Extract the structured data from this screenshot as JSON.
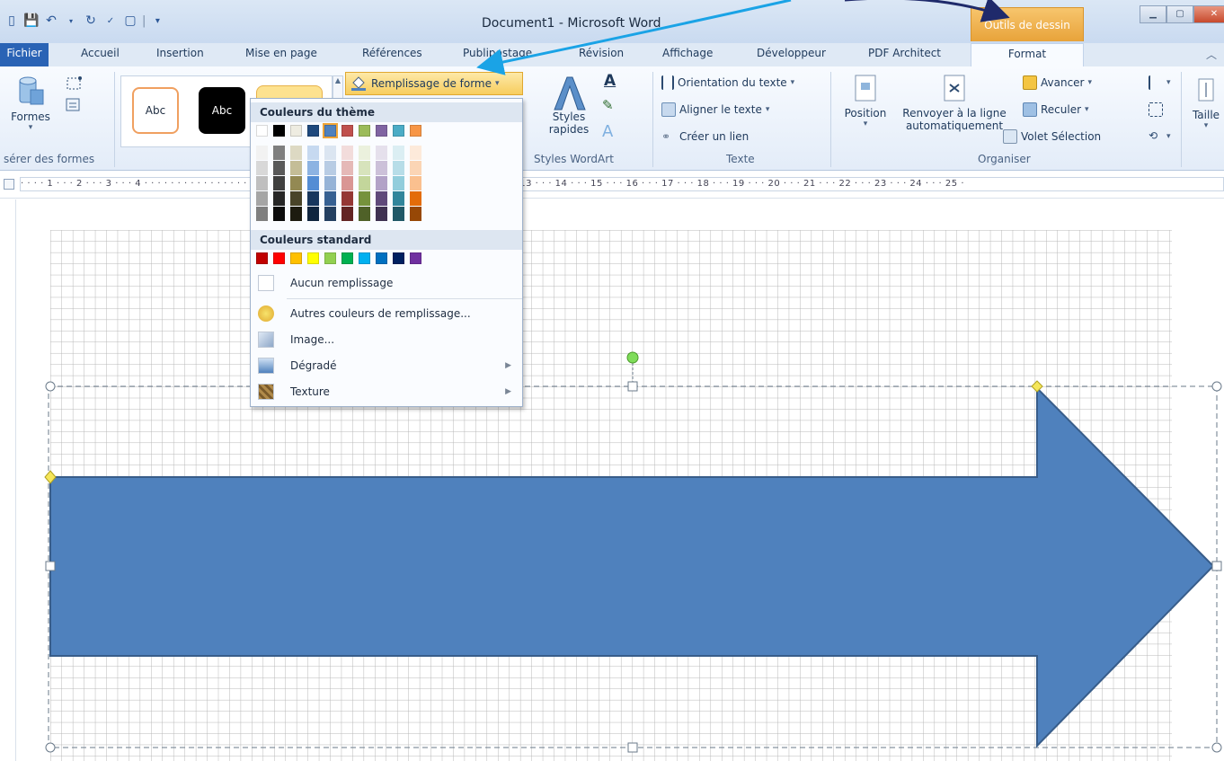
{
  "window": {
    "title": "Document1 - Microsoft Word",
    "context_tab": "Outils de dessin",
    "controls": [
      "minimize",
      "maximize",
      "close"
    ]
  },
  "qat": {
    "icons": [
      "word-icon",
      "save-icon",
      "undo-icon",
      "redo-icon",
      "spellcheck-icon",
      "new-doc-icon",
      "customize-icon"
    ]
  },
  "tabs": [
    "Fichier",
    "Accueil",
    "Insertion",
    "Mise en page",
    "Références",
    "Publipostage",
    "Révision",
    "Affichage",
    "Développeur",
    "PDF Architect",
    "Format"
  ],
  "ribbon": {
    "insert_shapes": {
      "formes_label": "Formes",
      "group_label": "sérer des formes"
    },
    "shape_styles": {
      "sample1": "Abc",
      "sample2": "Abc",
      "fill_button": "Remplissage de forme"
    },
    "wordart": {
      "styles_label_1": "Styles",
      "styles_label_2": "rapides",
      "group_label": "Styles WordArt"
    },
    "text": {
      "orientation": "Orientation du texte",
      "align": "Aligner le texte",
      "link": "Créer un lien",
      "group_label": "Texte"
    },
    "arrange": {
      "position": "Position",
      "wrap_1": "Renvoyer à la ligne",
      "wrap_2": "automatiquement",
      "forward": "Avancer",
      "backward": "Reculer",
      "selection_pane": "Volet Sélection",
      "group_label": "Organiser"
    },
    "size": {
      "label": "Taille"
    }
  },
  "ruler": {
    "text": "· · · · 1 · · · 2 · · · 3 · · · 4 · · · · · · · · · · · · · · · · · · · · · · · · · · · · · · · · · · · · · · · · · · · · · · 11 · · · 12 · · · 13 · · · 14 · · · 15 · · · 16 · · · 17 · · · 18 · · · 19 · · · 20 · · · 21 · · · 22 · · · 23 · · · 24 · · · 25 ·"
  },
  "dropdown": {
    "theme_colors_title": "Couleurs du thème",
    "standard_colors_title": "Couleurs standard",
    "no_fill": "Aucun remplissage",
    "more_colors": "Autres couleurs de remplissage...",
    "image": "Image...",
    "gradient": "Dégradé",
    "texture": "Texture",
    "theme_row": [
      "#ffffff",
      "#000000",
      "#eeece1",
      "#1f497d",
      "#4f81bd",
      "#c0504d",
      "#9bbb59",
      "#8064a2",
      "#4bacc6",
      "#f79646"
    ],
    "theme_shades": [
      [
        "#f2f2f2",
        "#7f7f7f",
        "#ddd9c3",
        "#c6d9f0",
        "#dbe5f1",
        "#f2dcdb",
        "#ebf1dd",
        "#e5e0ec",
        "#dbeef3",
        "#fdeada"
      ],
      [
        "#d8d8d8",
        "#595959",
        "#c4bd97",
        "#8db3e2",
        "#b8cce4",
        "#e5b9b7",
        "#d7e3bc",
        "#ccc1d9",
        "#b7dde8",
        "#fbd5b5"
      ],
      [
        "#bfbfbf",
        "#3f3f3f",
        "#938953",
        "#548dd4",
        "#95b3d7",
        "#d99694",
        "#c3d69b",
        "#b2a2c7",
        "#92cddc",
        "#fac08f"
      ],
      [
        "#a5a5a5",
        "#262626",
        "#494429",
        "#17365d",
        "#366092",
        "#953734",
        "#76923c",
        "#5f497a",
        "#31859b",
        "#e36c09"
      ],
      [
        "#7f7f7f",
        "#0c0c0c",
        "#1d1b10",
        "#0f243e",
        "#244061",
        "#632423",
        "#4f6128",
        "#3f3151",
        "#205867",
        "#974806"
      ]
    ],
    "standard_row": [
      "#c00000",
      "#ff0000",
      "#ffc000",
      "#ffff00",
      "#92d050",
      "#00b050",
      "#00b0f0",
      "#0070c0",
      "#002060",
      "#7030a0"
    ],
    "selected_index": 4
  },
  "shape": {
    "fill": "#4f81bd",
    "stroke": "#385d8a",
    "kind": "right-arrow"
  },
  "colors": {
    "accent_orange": "#f0a537",
    "file_tab": "#2a63b5",
    "annotation_dark": "#1f2a6b",
    "annotation_light": "#1aa3e6"
  }
}
